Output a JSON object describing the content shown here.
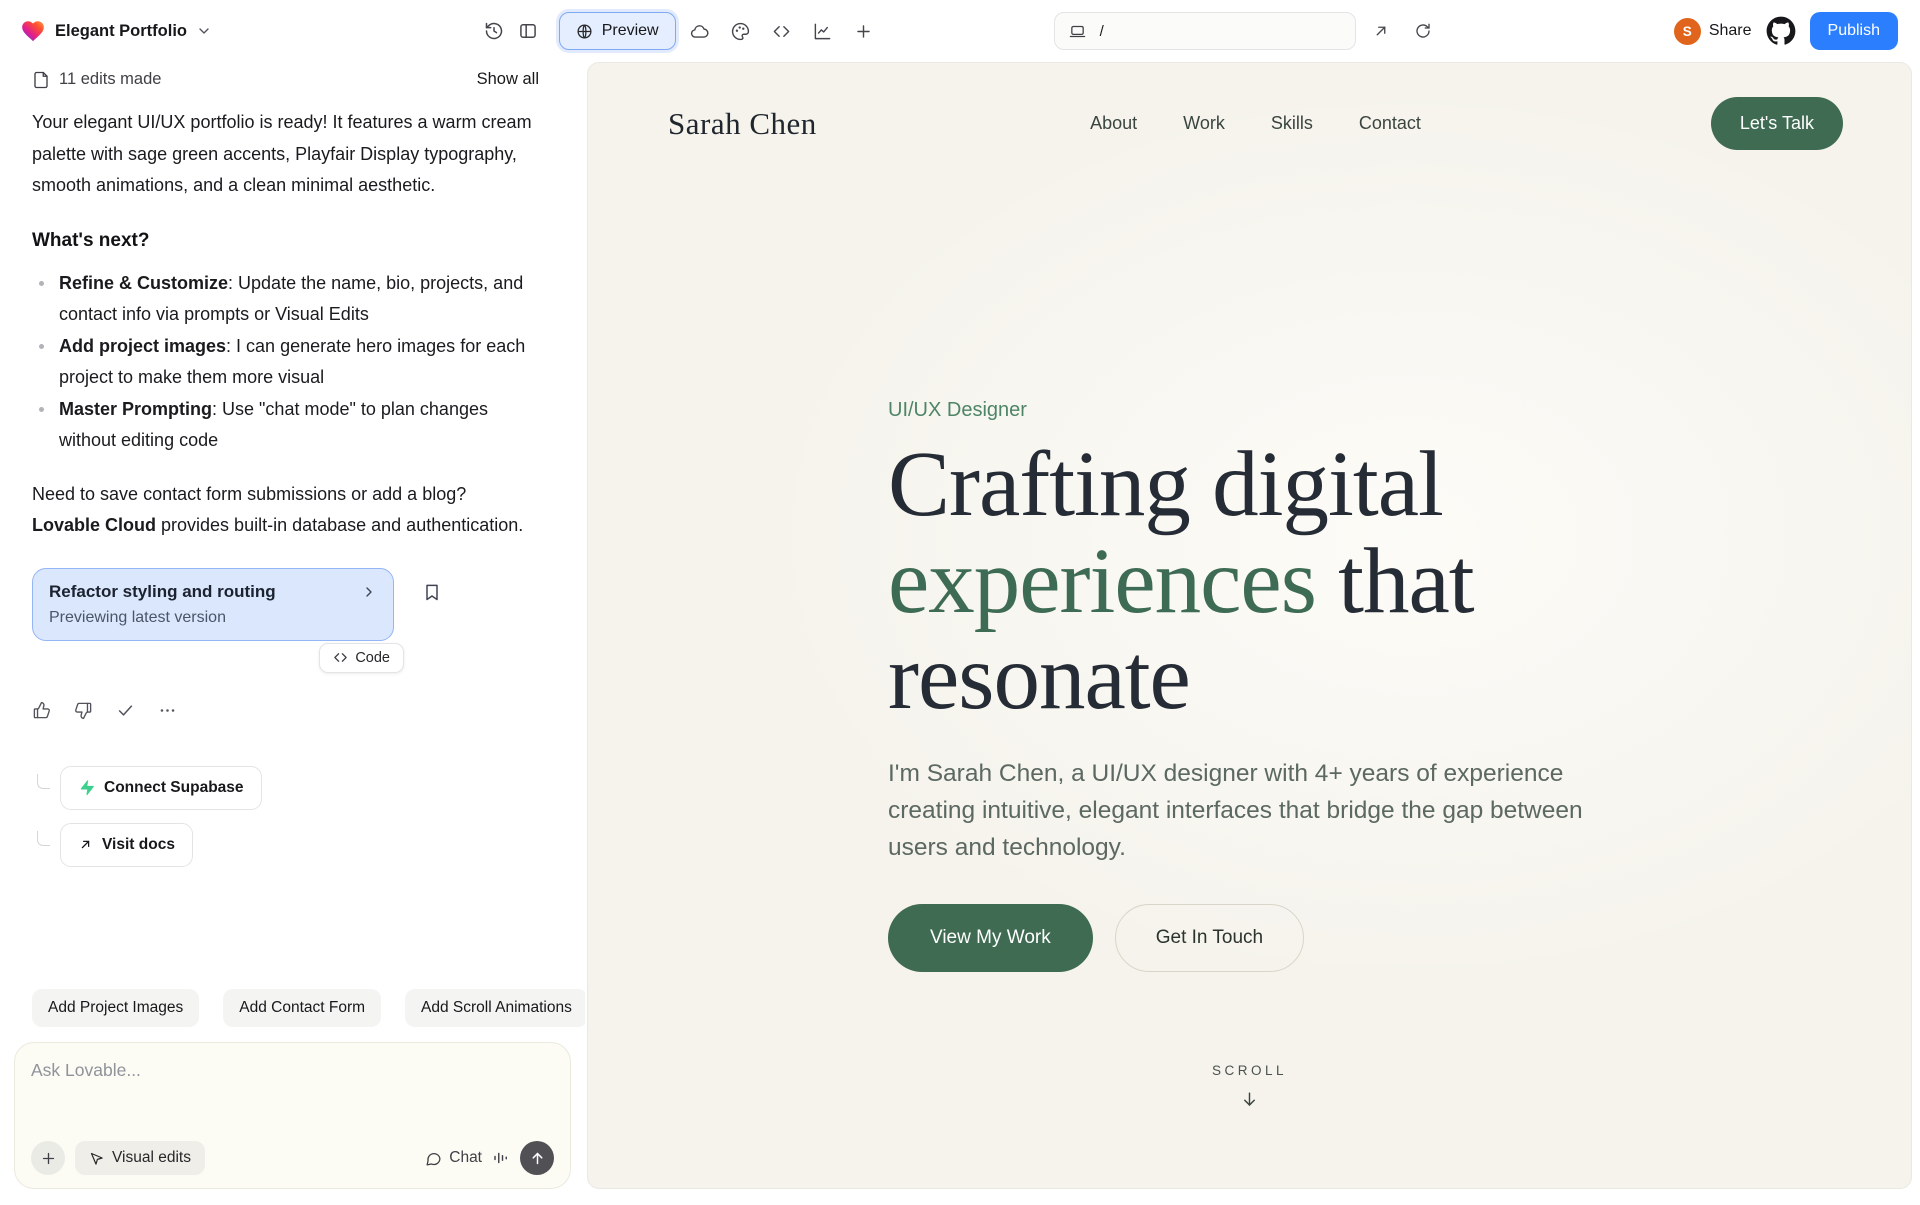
{
  "topbar": {
    "project_name": "Elegant Portfolio",
    "preview_label": "Preview",
    "url_path": "/",
    "avatar_initial": "S",
    "share_label": "Share",
    "publish_label": "Publish"
  },
  "sidebar": {
    "edits_summary": "11 edits made",
    "show_all_label": "Show all",
    "intro": "Your elegant UI/UX portfolio is ready! It features a warm cream palette with sage green accents, Playfair Display typography, smooth animations, and a clean minimal aesthetic.",
    "whats_next_heading": "What's next?",
    "bullets": [
      {
        "bold": "Refine & Customize",
        "rest": ": Update the name, bio, projects, and contact info via prompts or Visual Edits"
      },
      {
        "bold": "Add project images",
        "rest": ": I can generate hero images for each project to make them more visual"
      },
      {
        "bold": "Master Prompting",
        "rest": ": Use \"chat mode\" to plan changes without editing code"
      }
    ],
    "cloud_note": {
      "before": "Need to save contact form submissions or add a blog? ",
      "bold": "Lovable Cloud",
      "after": " provides built-in database and authentication."
    },
    "version_card": {
      "title": "Refactor styling and routing",
      "subtitle": "Previewing latest version"
    },
    "code_chip_label": "Code",
    "connect_supabase_label": "Connect Supabase",
    "visit_docs_label": "Visit docs",
    "suggestion_chips": [
      "Add Project Images",
      "Add Contact Form",
      "Add Scroll Animations"
    ],
    "composer": {
      "placeholder": "Ask Lovable...",
      "visual_edits_label": "Visual edits",
      "chat_label": "Chat"
    }
  },
  "preview_site": {
    "brand": "Sarah Chen",
    "nav": [
      "About",
      "Work",
      "Skills",
      "Contact"
    ],
    "cta_label": "Let's Talk",
    "hero": {
      "eyebrow": "UI/UX Designer",
      "heading_line1": "Crafting digital",
      "heading_line2_accent": "experiences",
      "heading_line2_rest": " that",
      "heading_line3": "resonate",
      "bio": "I'm Sarah Chen, a UI/UX designer with 4+ years of experience creating intuitive, elegant interfaces that bridge the gap between users and technology.",
      "primary_cta": "View My Work",
      "secondary_cta": "Get In Touch",
      "scroll_label": "SCROLL"
    }
  },
  "colors": {
    "accent_green": "#3E6B51",
    "eyebrow_green": "#4E8566",
    "publish_blue": "#2B7FFF",
    "version_card_bg": "#DBE7FC",
    "version_card_border": "#94B5F6",
    "preview_bg": "#F5F3EC",
    "avatar_orange": "#E0641C"
  }
}
